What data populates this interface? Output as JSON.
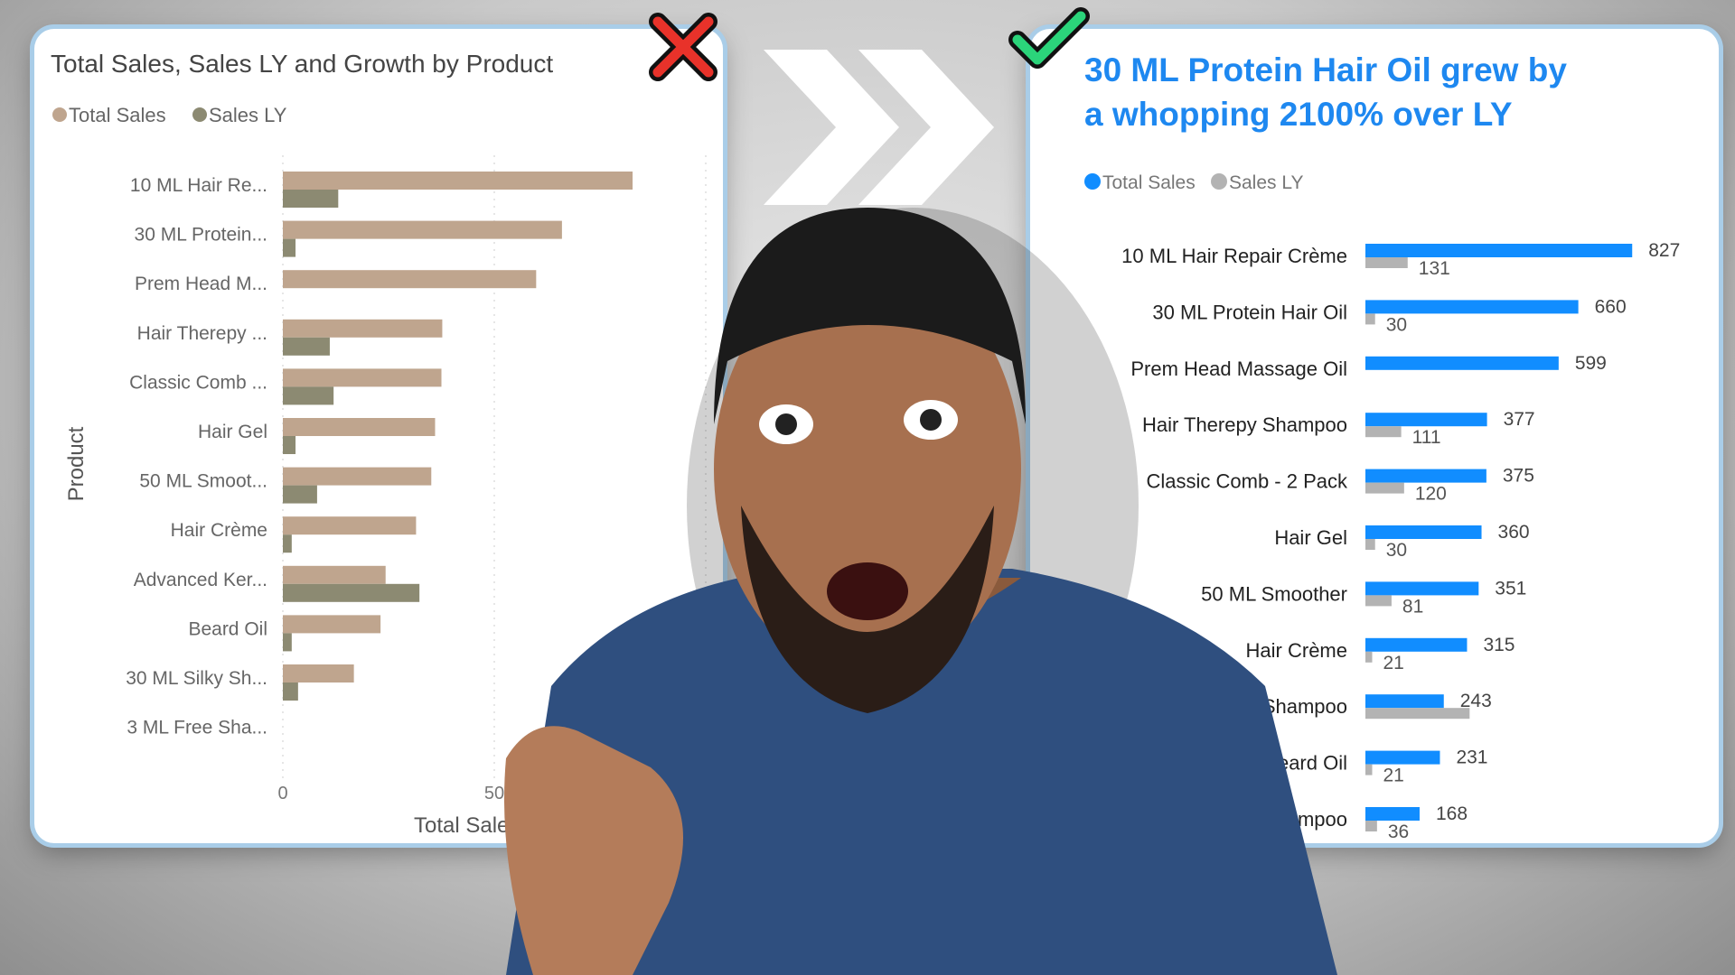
{
  "chart_data": [
    {
      "type": "bar",
      "orientation": "horizontal",
      "title": "Total Sales, Sales LY and Growth by Product",
      "ylabel": "Product",
      "xlabel": "Total Sales a",
      "x_ticks": [
        "0",
        "50"
      ],
      "xlim": [
        0,
        1000
      ],
      "grid": true,
      "legend_position": "top-left",
      "categories": [
        "10 ML Hair Re...",
        "30 ML Protein...",
        "Prem Head M...",
        "Hair Therepy ...",
        "Classic Comb ...",
        "Hair Gel",
        "50 ML Smoot...",
        "Hair Crème",
        "Advanced Ker...",
        "Beard Oil",
        "30 ML Silky Sh...",
        "3 ML Free Sha..."
      ],
      "series": [
        {
          "name": "Total Sales",
          "color": "#BFA58E",
          "values": [
            827,
            660,
            599,
            377,
            375,
            360,
            351,
            315,
            243,
            231,
            168,
            0
          ]
        },
        {
          "name": "Sales LY",
          "color": "#8C8A72",
          "values": [
            131,
            30,
            0,
            111,
            120,
            30,
            81,
            21,
            323,
            21,
            36,
            0
          ]
        }
      ]
    },
    {
      "type": "bar",
      "orientation": "horizontal",
      "title": "30 ML Protein Hair Oil grew by a whopping 2100% over LY",
      "legend_position": "top-left",
      "grid": false,
      "categories": [
        "10 ML Hair Repair Crème",
        "30 ML Protein Hair Oil",
        "Prem Head Massage Oil",
        "Hair Therepy Shampoo",
        "Classic Comb - 2 Pack",
        "Hair Gel",
        "50 ML Smoother",
        "Hair Crème",
        "n Shampoo",
        "eard Oil",
        "mpoo"
      ],
      "series": [
        {
          "name": "Total Sales",
          "color": "#118DFF",
          "values": [
            827,
            660,
            599,
            377,
            375,
            360,
            351,
            315,
            243,
            231,
            168
          ],
          "labels": [
            "827",
            "660",
            "599",
            "377",
            "375",
            "360",
            "351",
            "315",
            "243",
            "231",
            "168"
          ]
        },
        {
          "name": "Sales LY",
          "color": "#B3B3B3",
          "values": [
            131,
            30,
            0,
            111,
            120,
            30,
            81,
            21,
            323,
            21,
            36
          ],
          "labels": [
            "131",
            "30",
            "",
            "111",
            "120",
            "30",
            "81",
            "21",
            "",
            "21",
            "36"
          ]
        }
      ]
    }
  ],
  "decor": {
    "bad_mark": "cross-icon",
    "good_mark": "check-icon",
    "arrow": "double-chevron-right-icon",
    "bad_color": "#E8322A",
    "good_color": "#2BD47A"
  }
}
